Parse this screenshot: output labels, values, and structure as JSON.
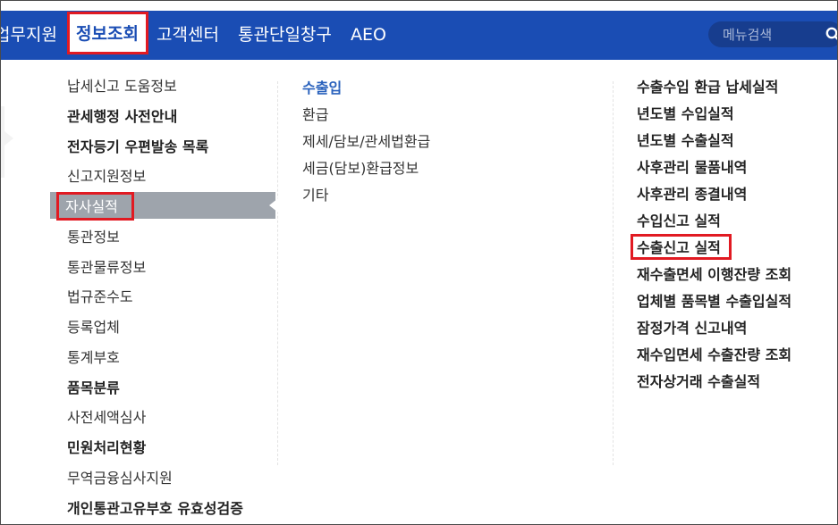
{
  "topnav": {
    "items": [
      {
        "label": "업무지원"
      },
      {
        "label": "정보조회"
      },
      {
        "label": "고객센터"
      },
      {
        "label": "통관단일창구"
      },
      {
        "label": "AEO"
      }
    ],
    "search_placeholder": "메뉴검색"
  },
  "columns": {
    "left": [
      {
        "label": "납세신고 도움정보"
      },
      {
        "label": "관세행정 사전안내"
      },
      {
        "label": "전자등기 우편발송 목록"
      },
      {
        "label": "신고지원정보"
      },
      {
        "label": "자사실적"
      },
      {
        "label": "통관정보"
      },
      {
        "label": "통관물류정보"
      },
      {
        "label": "법규준수도"
      },
      {
        "label": "등록업체"
      },
      {
        "label": "통계부호"
      },
      {
        "label": "품목분류"
      },
      {
        "label": "사전세액심사"
      },
      {
        "label": "민원처리현황"
      },
      {
        "label": "무역금융심사지원"
      },
      {
        "label": "개인통관고유부호 유효성검증"
      }
    ],
    "middle": [
      {
        "label": "수출입"
      },
      {
        "label": "환급"
      },
      {
        "label": "제세/담보/관세법환급"
      },
      {
        "label": "세금(담보)환급정보"
      },
      {
        "label": "기타"
      }
    ],
    "right": [
      {
        "label": "수출수입 환급 납세실적"
      },
      {
        "label": "년도별 수입실적"
      },
      {
        "label": "년도별 수출실적"
      },
      {
        "label": "사후관리 물품내역"
      },
      {
        "label": "사후관리 종결내역"
      },
      {
        "label": "수입신고 실적"
      },
      {
        "label": "수출신고 실적"
      },
      {
        "label": "재수출면세 이행잔량 조회"
      },
      {
        "label": "업체별 품목별 수출입실적"
      },
      {
        "label": "잠정가격 신고내역"
      },
      {
        "label": "재수입면세 수출잔량 조회"
      },
      {
        "label": "전자상거래 수출실적"
      }
    ]
  },
  "colors": {
    "nav_bg": "#1a4db4",
    "active_text": "#1a4db4",
    "highlight_bg": "#9ea4ac",
    "annotation_red": "#e11a22",
    "category_blue": "#2a62bd"
  }
}
